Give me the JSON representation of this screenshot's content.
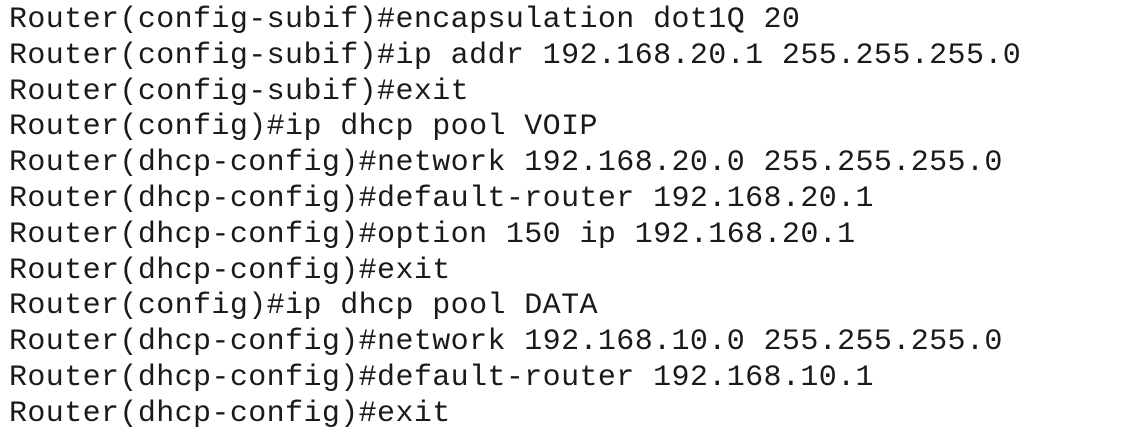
{
  "terminal": {
    "lines": [
      "Router(config-subif)#encapsulation dot1Q 20",
      "Router(config-subif)#ip addr 192.168.20.1 255.255.255.0",
      "Router(config-subif)#exit",
      "Router(config)#ip dhcp pool VOIP",
      "Router(dhcp-config)#network 192.168.20.0 255.255.255.0",
      "Router(dhcp-config)#default-router 192.168.20.1",
      "Router(dhcp-config)#option 150 ip 192.168.20.1",
      "Router(dhcp-config)#exit",
      "Router(config)#ip dhcp pool DATA",
      "Router(dhcp-config)#network 192.168.10.0 255.255.255.0",
      "Router(dhcp-config)#default-router 192.168.10.1",
      "Router(dhcp-config)#exit"
    ]
  }
}
